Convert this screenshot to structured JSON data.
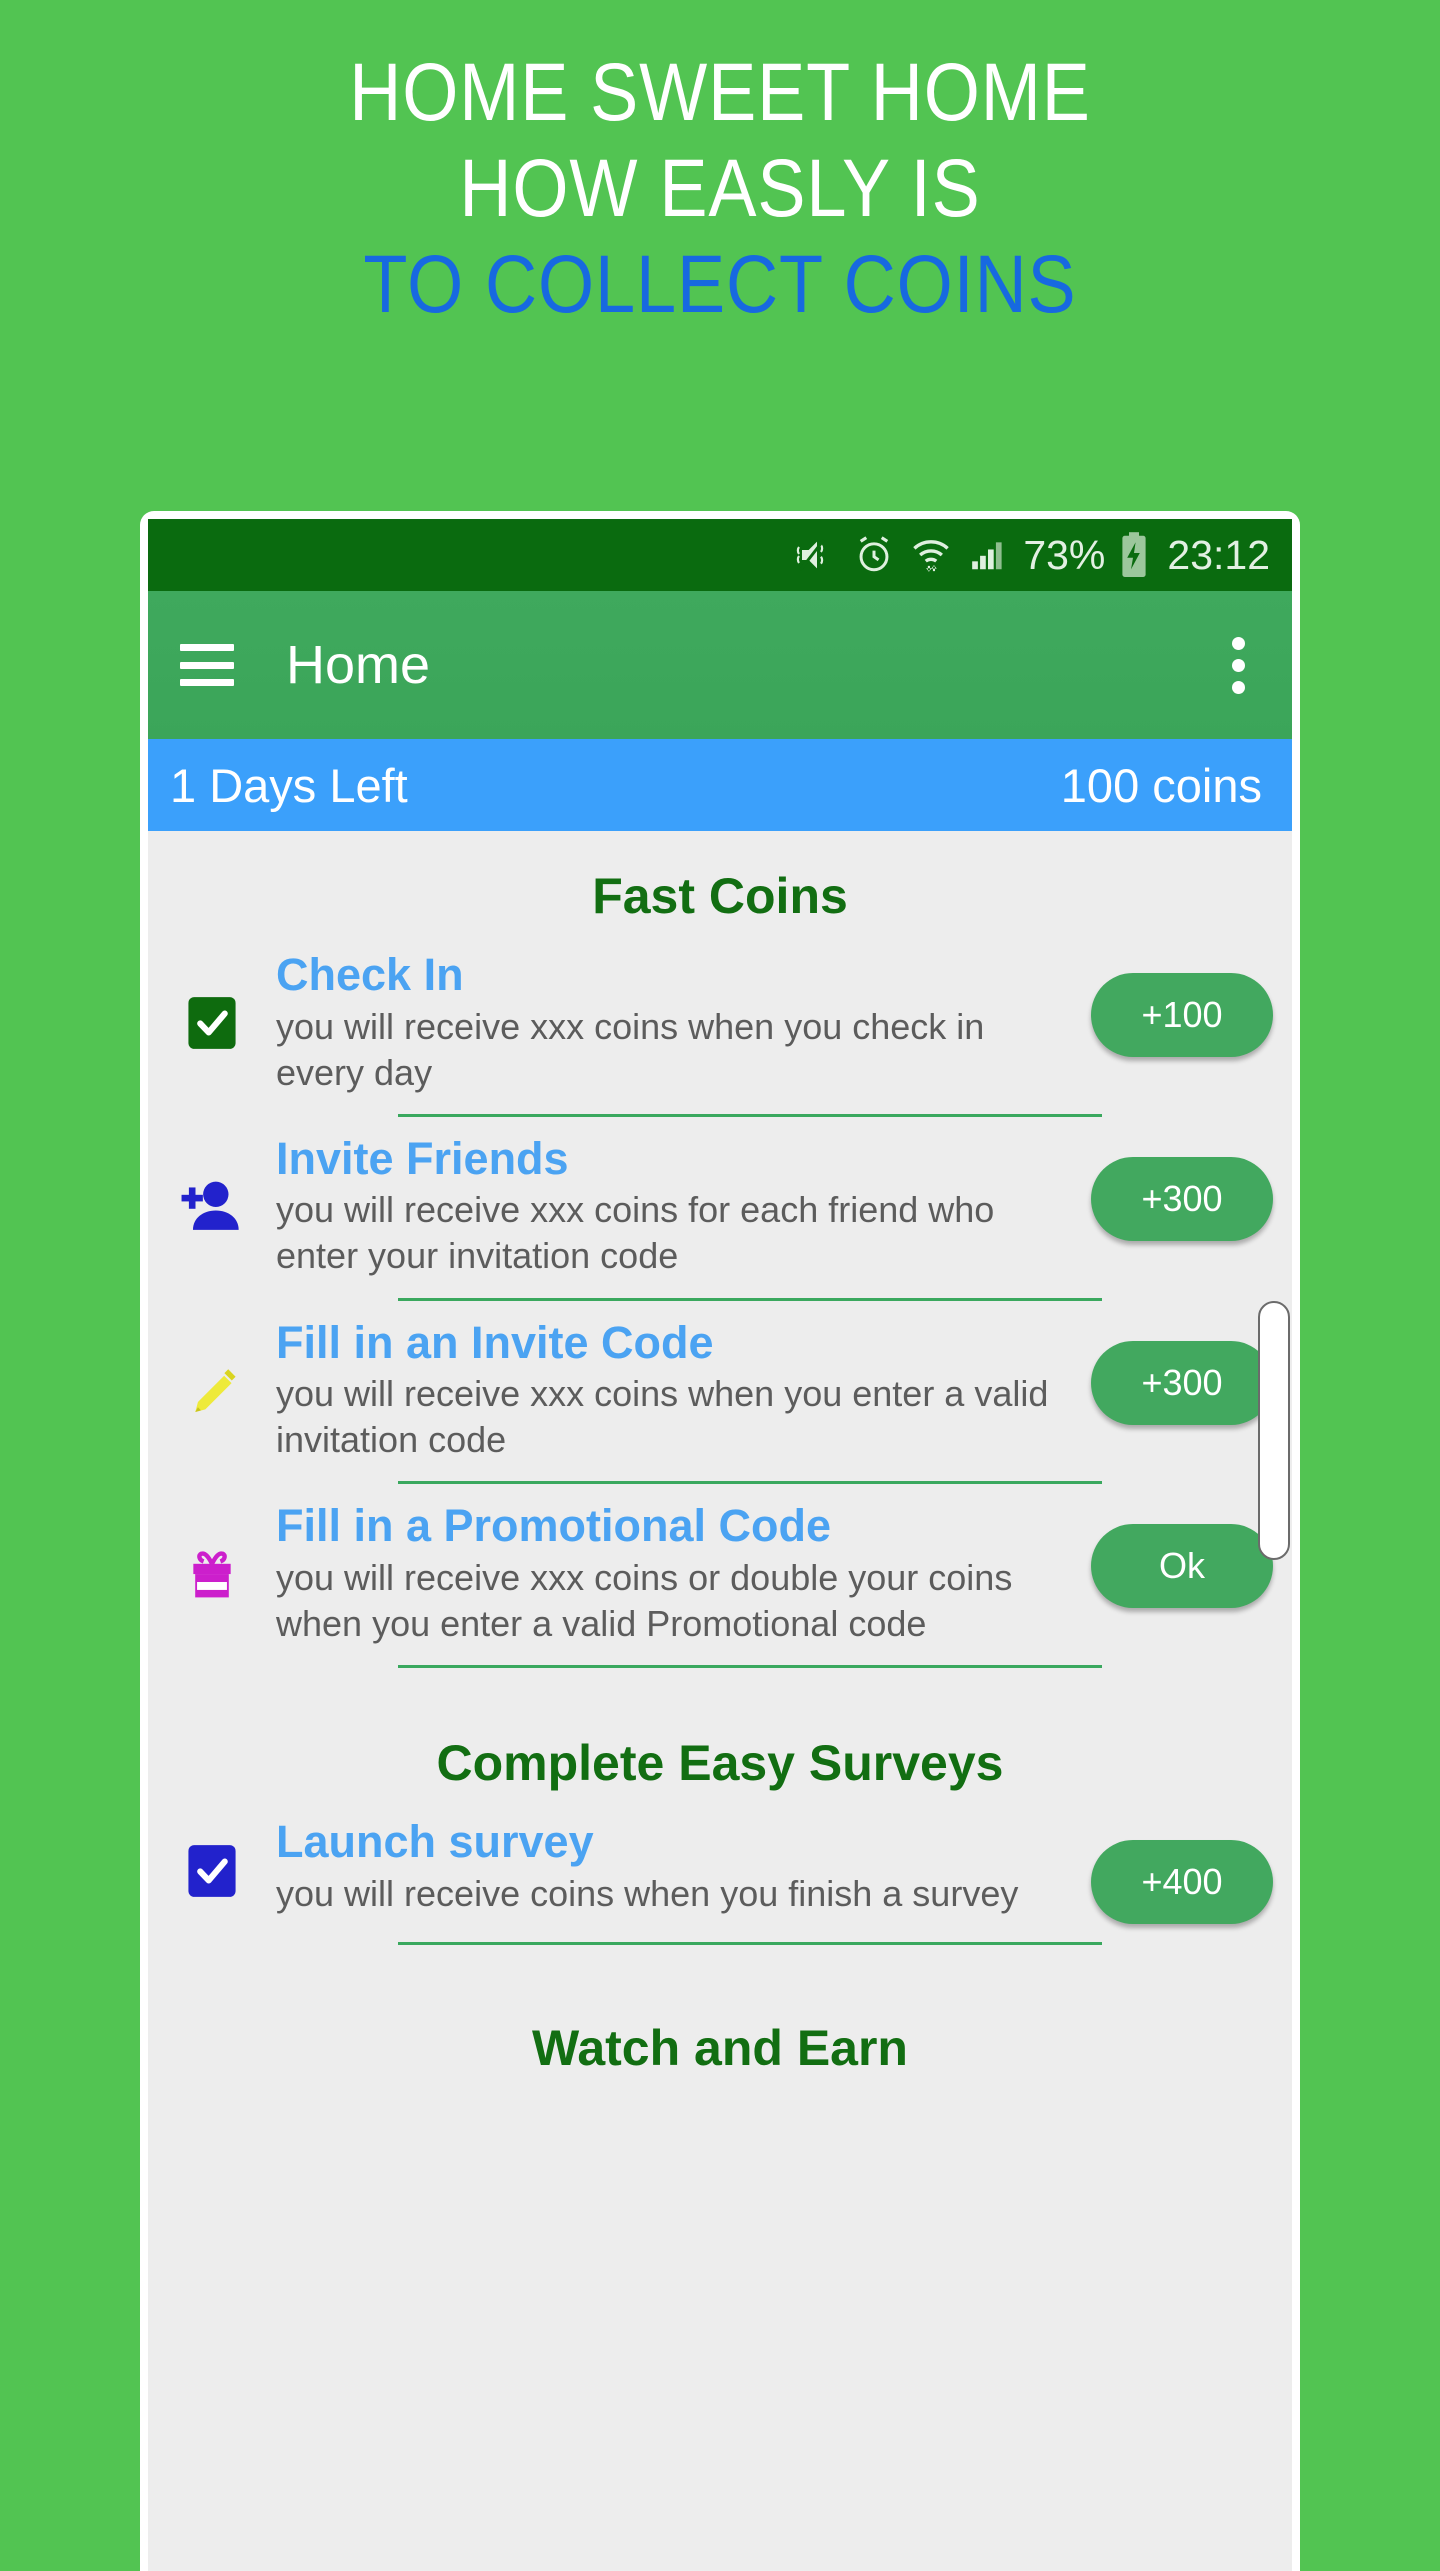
{
  "promo": {
    "line1": "HOME SWEET HOME",
    "line2": "HOW EASLY IS",
    "line3": "TO COLLECT COINS",
    "white_color": "#ffffff",
    "blue_color": "#1769e0",
    "background_color": "#52c452"
  },
  "statusbar": {
    "icons": [
      "mute-vibrate-icon",
      "alarm-icon",
      "wifi-icon",
      "signal-icon"
    ],
    "battery_percent": "73%",
    "battery_state": "charging",
    "clock": "23:12",
    "background_color": "#0a6b0f"
  },
  "appbar": {
    "menu_icon": "hamburger-icon",
    "title": "Home",
    "overflow_icon": "overflow-menu-icon",
    "background_color": "#3ea85c"
  },
  "banner": {
    "days_left": "1 Days Left",
    "coins": "100 coins",
    "background_color": "#3ba0fb"
  },
  "sections": [
    {
      "title": "Fast Coins",
      "items": [
        {
          "icon": "checkbox-checked-green-icon",
          "title": "Check In",
          "desc": "you will receive xxx coins when you check in every day",
          "action": "+100"
        },
        {
          "icon": "person-add-icon",
          "title": "Invite Friends",
          "desc": "you will receive xxx coins for each friend who enter your invitation code",
          "action": "+300"
        },
        {
          "icon": "pencil-icon",
          "title": "Fill in an Invite Code",
          "desc": "you will receive xxx coins when you enter a valid invitation code",
          "action": "+300"
        },
        {
          "icon": "gift-icon",
          "title": "Fill in a Promotional Code",
          "desc": "you will receive xxx coins or double your coins when you enter a valid Promotional code",
          "action": "Ok"
        }
      ]
    },
    {
      "title": "Complete Easy Surveys",
      "items": [
        {
          "icon": "checkbox-checked-blue-icon",
          "title": "Launch survey",
          "desc": "you will receive coins when you finish a survey",
          "action": "+400"
        }
      ]
    },
    {
      "title": "Watch and Earn",
      "items": []
    }
  ],
  "colors": {
    "section_title": "#126e12",
    "item_title": "#4ba3f2",
    "item_desc": "#5c5c5c",
    "pill": "#42a85f",
    "divider": "#3aa85e",
    "screen_bg": "#ededed"
  }
}
